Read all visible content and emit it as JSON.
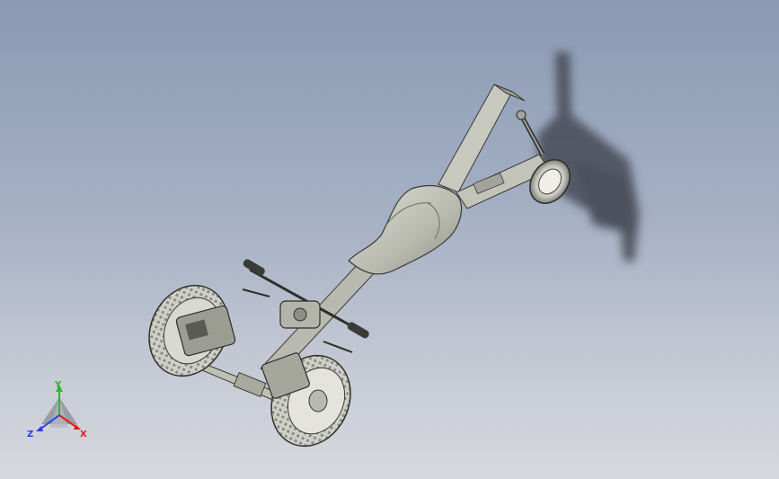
{
  "viewport": {
    "background_top": "#8a9ab3",
    "background_bottom": "#d6d8de",
    "model_name": "",
    "model_color": "#c2c3b9",
    "tire_color": "#c9c9c0",
    "shadow_color": "#3a3e46"
  },
  "triad": {
    "x_label": "X",
    "y_label": "Y",
    "z_label": "Z",
    "x_color": "#e0201b",
    "y_color": "#2eb82e",
    "z_color": "#2a3fe0"
  }
}
